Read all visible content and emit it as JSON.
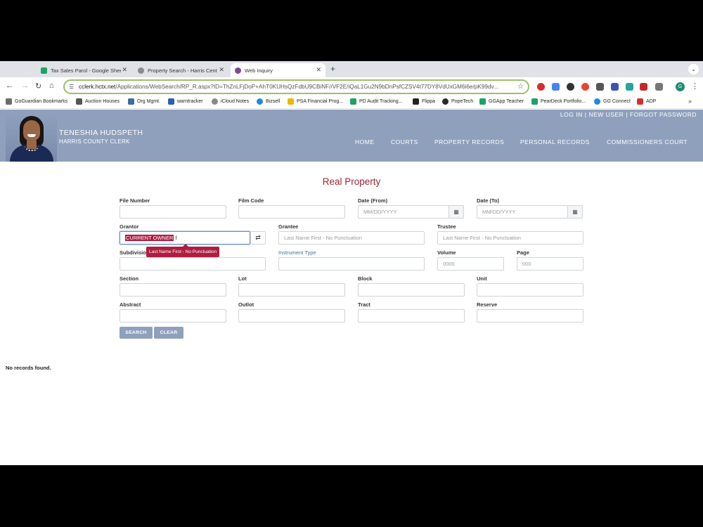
{
  "browser": {
    "tabs": [
      {
        "title": "Tax Sales Parol - Google Shee",
        "favicon_color": "#1ea362"
      },
      {
        "title": "Property Search - Harris Cent",
        "favicon_color": "#8a8a8a"
      },
      {
        "title": "Web Inquiry",
        "favicon_color": "#7b4b8f"
      }
    ],
    "url_host": "cclerk.hctx.net",
    "url_path": "/Applications/WebSearch/RP_R.aspx?ID=ThZnLFjDoP+AhT0KUHsQzFdbU9CBiNF//VF2E/iQaL1Gu2N9bDnPsfCZSV4t77DY8VdUxGM6i6e/pK99dv...",
    "profile_initial": "G",
    "bookmarks": [
      {
        "label": "GoGuardian Bookmarks",
        "color": "#6d6d6d"
      },
      {
        "label": "Auction Houses",
        "color": "#555555"
      },
      {
        "label": "Org Mgmt.",
        "color": "#3a6ea5"
      },
      {
        "label": "warntracker",
        "color": "#2b5fb4"
      },
      {
        "label": "iCloud Notes",
        "color": "#888888"
      },
      {
        "label": "Bizsell",
        "color": "#1e88e5"
      },
      {
        "label": "PSA Financial Prog...",
        "color": "#f4b400"
      },
      {
        "label": "PD Audit Tracking...",
        "color": "#1ea362"
      },
      {
        "label": "Flippa",
        "color": "#222222"
      },
      {
        "label": "PopeTech",
        "color": "#2b2b2b"
      },
      {
        "label": "GGApp Teacher",
        "color": "#1ea362"
      },
      {
        "label": "PearDeck Portfolio...",
        "color": "#1ea362"
      },
      {
        "label": "GG Connect",
        "color": "#1e88e5"
      },
      {
        "label": "ADP",
        "color": "#d32f2f"
      }
    ]
  },
  "header": {
    "name": "TENESHIA HUDSPETH",
    "title": "HARRIS COUNTY CLERK",
    "top_links": [
      "LOG IN",
      "NEW USER",
      "FORGOT PASSWORD"
    ],
    "nav": [
      "HOME",
      "COURTS",
      "PROPERTY RECORDS",
      "PERSONAL RECORDS",
      "COMMISSIONERS COURT"
    ]
  },
  "form": {
    "title": "Real Property",
    "labels": {
      "file_number": "File Number",
      "film_code": "Film Code",
      "date_from": "Date (From)",
      "date_to": "Date (To)",
      "grantor": "Grantor",
      "grantee": "Grantee",
      "trustee": "Trustee",
      "subdivision": "Subdivisio",
      "instrument_type": "Instrument Type",
      "volume": "Volume",
      "page": "Page",
      "section": "Section",
      "lot": "Lot",
      "block": "Block",
      "unit": "Unit",
      "abstract": "Abstract",
      "outlot": "Outlot",
      "tract": "Tract",
      "reserve": "Reserve"
    },
    "placeholders": {
      "date": "MM/DD/YYYY",
      "name": "Last Name First - No Punctuation",
      "volume": "0000",
      "page": "000"
    },
    "grantor_value": "CURRENT OWNER",
    "tooltip": "Last Name First - No Punctuation",
    "search_button": "SEARCH",
    "clear_button": "CLEAR"
  },
  "results": {
    "message": "No records found."
  }
}
